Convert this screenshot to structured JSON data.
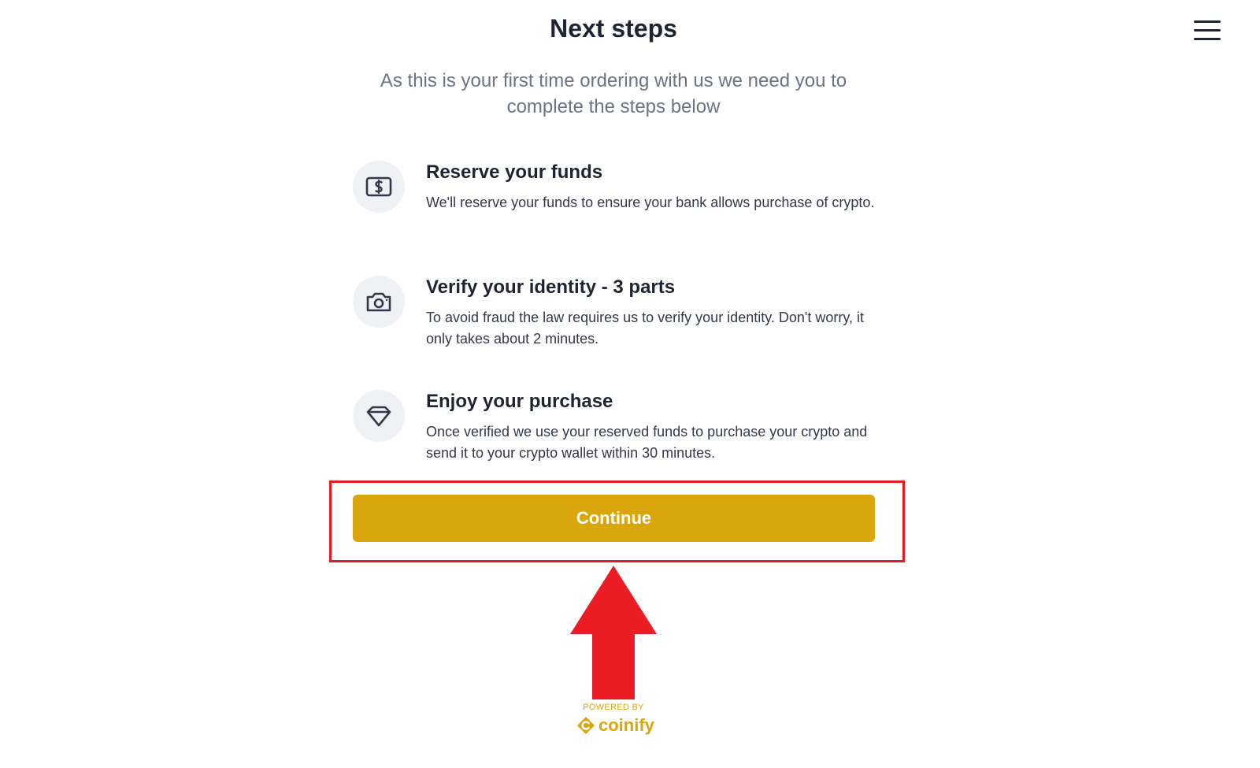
{
  "header": {
    "title": "Next steps",
    "subtitle": "As this is your first time ordering with us we need you to complete the steps below",
    "menu_icon": "hamburger-menu-icon"
  },
  "steps": [
    {
      "icon": "dollar-bill-icon",
      "title": "Reserve your funds",
      "description": "We'll reserve your funds to ensure your bank allows purchase of crypto."
    },
    {
      "icon": "camera-icon",
      "title": "Verify your identity - 3 parts",
      "description": "To avoid fraud the law requires us to verify your identity. Don't worry, it only takes about 2 minutes."
    },
    {
      "icon": "diamond-icon",
      "title": "Enjoy your purchase",
      "description": "Once verified we use your reserved funds to purchase your crypto and send it to your crypto wallet within 30 minutes."
    }
  ],
  "actions": {
    "continue_label": "Continue"
  },
  "footer": {
    "powered_by": "POWERED BY",
    "brand_name": "coinify",
    "brand_icon": "coinify-logo-icon"
  },
  "annotations": {
    "highlight_color": "#e31b23",
    "arrow_icon": "up-arrow-icon"
  },
  "colors": {
    "accent": "#d9a60b",
    "text_primary": "#1f2433",
    "text_secondary": "#6d7385",
    "icon_background": "#f0f1f4"
  }
}
